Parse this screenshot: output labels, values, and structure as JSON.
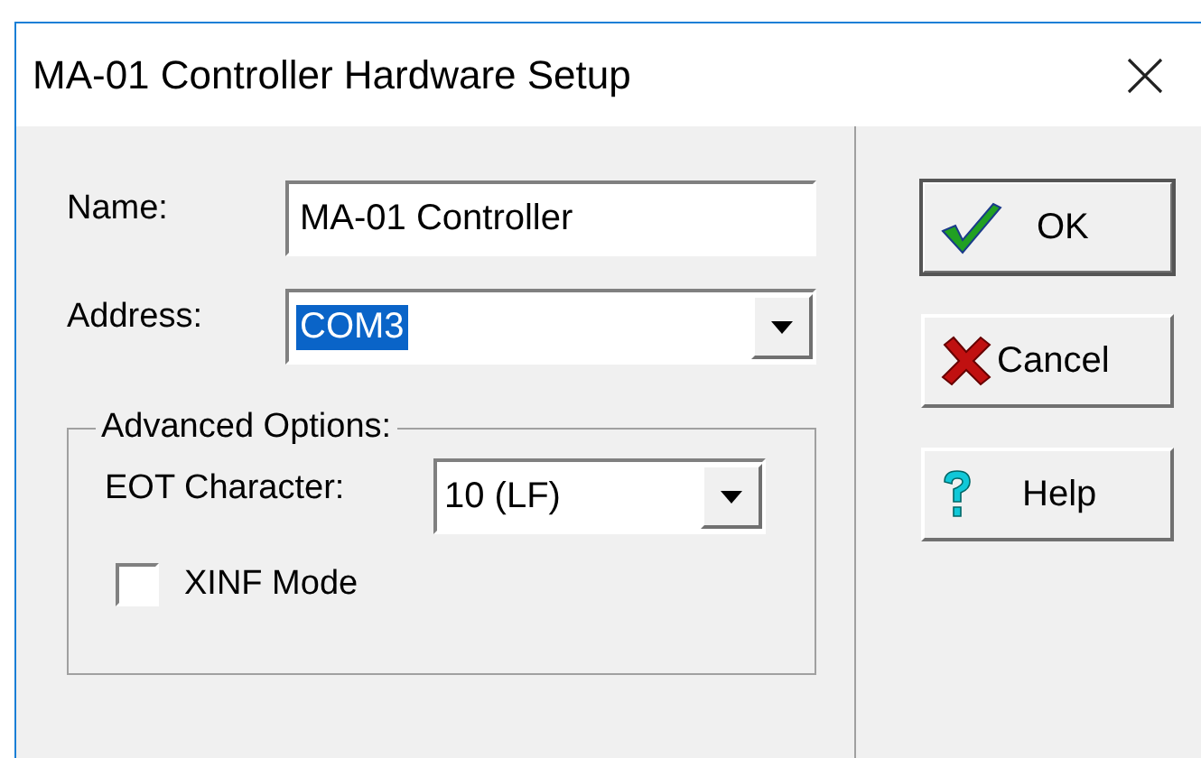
{
  "window": {
    "title": "MA-01 Controller Hardware Setup"
  },
  "name_field": {
    "label": "Name:",
    "value": "MA-01 Controller"
  },
  "address_field": {
    "label": "Address:",
    "value": "COM3",
    "selected": true
  },
  "advanced_options": {
    "title": "Advanced Options:",
    "eot_character": {
      "label": "EOT Character:",
      "value": "10 (LF)"
    },
    "xinf_mode": {
      "label": "XINF Mode",
      "checked": false
    }
  },
  "buttons": [
    {
      "label": "OK",
      "kind": "ok"
    },
    {
      "label": "Cancel",
      "kind": "cancel"
    },
    {
      "label": "Help",
      "kind": "help"
    }
  ]
}
